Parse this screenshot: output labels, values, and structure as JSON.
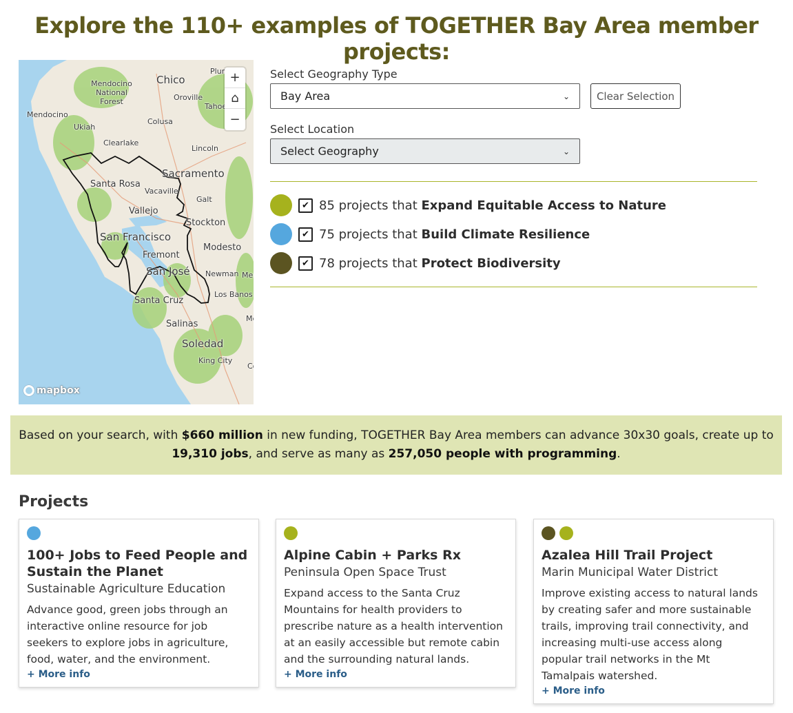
{
  "page": {
    "title": "Explore the 110+ examples of TOGETHER Bay Area member projects:"
  },
  "map": {
    "labels": [
      "Chico",
      "Mendocino National Forest",
      "Oroville",
      "Plum",
      "Tahoe",
      "Mendocino",
      "Ukiah",
      "Colusa",
      "Clearlake",
      "Lincoln",
      "Sacramento",
      "Santa Rosa",
      "Vacaville",
      "Galt",
      "Vallejo",
      "Stockton",
      "San Francisco",
      "Modesto",
      "Fremont",
      "San José",
      "Newman",
      "Mer",
      "Santa Cruz",
      "Los Banos",
      "Salinas",
      "Me",
      "Soledad",
      "King City",
      "Co"
    ],
    "zoom_in": "+",
    "home": "⌂",
    "zoom_out": "−",
    "attribution": "mapbox"
  },
  "controls": {
    "geography_type_label": "Select Geography Type",
    "geography_type_value": "Bay Area",
    "clear_label": "Clear Selection",
    "location_label": "Select Location",
    "location_value": "Select Geography"
  },
  "legend": [
    {
      "count_text": "85 projects that",
      "goal": "Expand Equitable Access to Nature",
      "color": "#a6b21d",
      "checked": true
    },
    {
      "count_text": "75 projects that",
      "goal": "Build Climate Resilience",
      "color": "#55a7de",
      "checked": true
    },
    {
      "count_text": "78 projects that",
      "goal": "Protect Biodiversity",
      "color": "#5b5421",
      "checked": true
    }
  ],
  "summary": {
    "p1": "Based on your search, with ",
    "funding": "$660 million",
    "p2": " in new funding, TOGETHER Bay Area members can advance 30x30 goals, create up to ",
    "jobs": "19,310 jobs",
    "p3": ", and serve as many as ",
    "people": "257,050 people with programming",
    "p4": "."
  },
  "projects": {
    "heading": "Projects",
    "more_label": "+ More info",
    "cards": [
      {
        "dots": [
          "#55a7de"
        ],
        "title": "100+ Jobs to Feed People and Sustain the Planet",
        "org": "Sustainable Agriculture Education",
        "desc": "Advance good, green jobs through an interactive online resource for job seekers to explore jobs in agriculture, food, water, and the environment."
      },
      {
        "dots": [
          "#a6b21d"
        ],
        "title": "Alpine Cabin + Parks Rx",
        "org": "Peninsula Open Space Trust",
        "desc": "Expand access to the Santa Cruz Mountains for health providers to prescribe nature as a health intervention at an easily accessible but remote cabin and the surrounding natural lands."
      },
      {
        "dots": [
          "#5b5421",
          "#a6b21d"
        ],
        "title": "Azalea Hill Trail Project",
        "org": "Marin Municipal Water District",
        "desc": "Improve existing access to natural lands by creating safer and more sustainable trails, improving trail connectivity, and increasing multi-use access along popular trail networks in the Mt Tamalpais watershed."
      }
    ]
  },
  "colors": {
    "title": "#5e5a1e",
    "divider": "#a9b52a",
    "banner_bg": "#dfe5b4",
    "link": "#2a5d88"
  }
}
